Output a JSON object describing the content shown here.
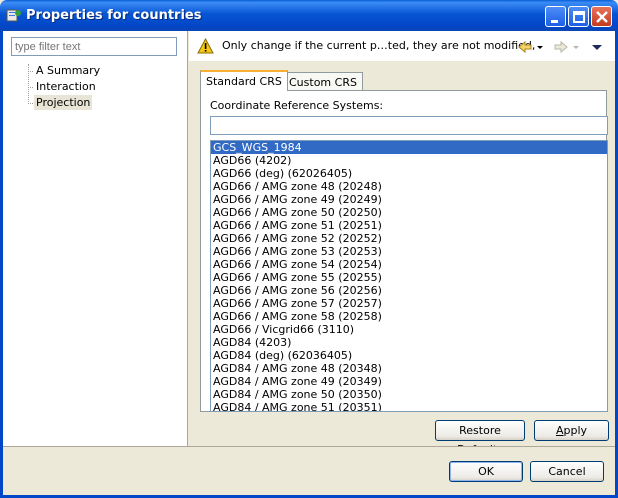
{
  "window": {
    "title": "Properties for countries"
  },
  "sidebar": {
    "filter_placeholder": "type filter text",
    "items": [
      {
        "label": "A Summary",
        "selected": false
      },
      {
        "label": "Interaction",
        "selected": false
      },
      {
        "label": "Projection",
        "selected": true
      }
    ]
  },
  "message": {
    "text": "Only change if the current p…ted, they are not modified,"
  },
  "tabs": [
    {
      "label": "Standard CRS",
      "active": true
    },
    {
      "label": "Custom CRS",
      "active": false
    }
  ],
  "crs": {
    "label": "Coordinate Reference Systems:",
    "search_value": "",
    "items": [
      "GCS_WGS_1984",
      "AGD66 (4202)",
      "AGD66 (deg) (62026405)",
      "AGD66 / AMG zone 48 (20248)",
      "AGD66 / AMG zone 49 (20249)",
      "AGD66 / AMG zone 50 (20250)",
      "AGD66 / AMG zone 51 (20251)",
      "AGD66 / AMG zone 52 (20252)",
      "AGD66 / AMG zone 53 (20253)",
      "AGD66 / AMG zone 54 (20254)",
      "AGD66 / AMG zone 55 (20255)",
      "AGD66 / AMG zone 56 (20256)",
      "AGD66 / AMG zone 57 (20257)",
      "AGD66 / AMG zone 58 (20258)",
      "AGD66 / Vicgrid66 (3110)",
      "AGD84 (4203)",
      "AGD84 (deg) (62036405)",
      "AGD84 / AMG zone 48 (20348)",
      "AGD84 / AMG zone 49 (20349)",
      "AGD84 / AMG zone 50 (20350)",
      "AGD84 / AMG zone 51 (20351)"
    ],
    "selected_index": 0
  },
  "buttons": {
    "restore_defaults_pre": "Restore ",
    "restore_defaults_mnemonic": "D",
    "restore_defaults_post": "efaults",
    "apply_mnemonic": "A",
    "apply_post": "pply",
    "ok": "OK",
    "cancel": "Cancel"
  },
  "colors": {
    "titlebar": "#0a5fd8",
    "selection": "#316ac5",
    "warning": "#f5c518"
  }
}
